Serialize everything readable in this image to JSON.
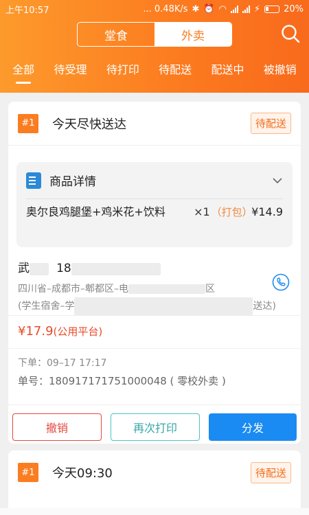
{
  "status_bar": {
    "time": "上午10:57",
    "network_speed": "... 0.48K/s",
    "battery": "20%"
  },
  "segment": {
    "dine_in": "堂食",
    "takeout": "外卖"
  },
  "tabs": [
    {
      "label": "全部"
    },
    {
      "label": "待受理"
    },
    {
      "label": "待打印"
    },
    {
      "label": "待配送"
    },
    {
      "label": "配送中"
    },
    {
      "label": "被撤销"
    }
  ],
  "orders": [
    {
      "number": "#1",
      "title": "今天尽快送达",
      "status": "待配送",
      "detail_title": "商品详情",
      "item": {
        "name": "奥尔良鸡腿堡+鸡米花+饮料",
        "qty": "×1",
        "pack": "（打包）",
        "price": "¥14.9"
      },
      "customer_name": "武",
      "customer_phone": "18",
      "address_line1": "四川省–成都市–郫都区–电",
      "address_end1": "区",
      "address_line2": "(学生宿舍–学",
      "address_end2": "送达)",
      "total": "¥17.9",
      "platform": "(公用平台)",
      "order_time": "下单：09–17 17:17",
      "order_no": "单号：180917171751000048 ( 零校外卖 )",
      "btn_cancel": "撤销",
      "btn_reprint": "再次打印",
      "btn_dispatch": "分发"
    },
    {
      "number": "#1",
      "title": "今天09:30",
      "status": "待配送"
    }
  ],
  "colors": {
    "accent": "#fb7d22",
    "dispatch_blue": "#1a8bf2",
    "price_red": "#e94a2a"
  }
}
